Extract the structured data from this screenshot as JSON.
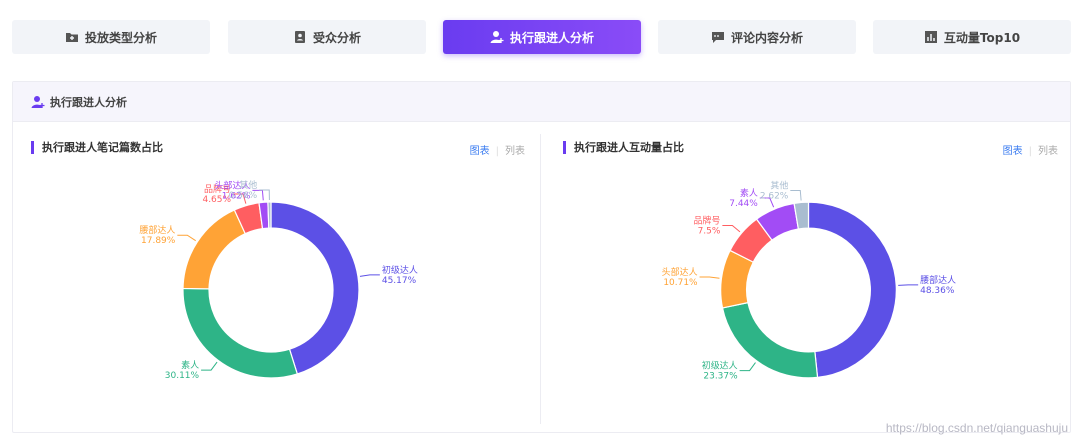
{
  "tabs": [
    {
      "label": "投放类型分析",
      "icon": "folder-icon",
      "active": false
    },
    {
      "label": "受众分析",
      "icon": "contact-card-icon",
      "active": false
    },
    {
      "label": "执行跟进人分析",
      "icon": "user-icon",
      "active": true
    },
    {
      "label": "评论内容分析",
      "icon": "comment-icon",
      "active": false
    },
    {
      "label": "互动量Top10",
      "icon": "bar-chart-icon",
      "active": false
    }
  ],
  "panel": {
    "title": "执行跟进人分析"
  },
  "toggle": {
    "chart": "图表",
    "list": "列表"
  },
  "colors": {
    "accent": "#6a3cf0"
  },
  "chart_data": [
    {
      "type": "pie",
      "title": "执行跟进人笔记篇数占比",
      "donut": true,
      "slices": [
        {
          "name": "初级达人",
          "value": 45.17,
          "label": "45.17%",
          "color": "#5c50e6"
        },
        {
          "name": "素人",
          "value": 30.11,
          "label": "30.11%",
          "color": "#2eb487"
        },
        {
          "name": "腰部达人",
          "value": 17.89,
          "label": "17.89%",
          "color": "#ffa336"
        },
        {
          "name": "品牌号",
          "value": 4.65,
          "label": "4.65%",
          "color": "#ff5e61"
        },
        {
          "name": "头部达人",
          "value": 1.62,
          "label": "1.62%",
          "color": "#a24cf5"
        },
        {
          "name": "其他",
          "value": 0.56,
          "label": "0.56%",
          "color": "#a9bdd0"
        }
      ]
    },
    {
      "type": "pie",
      "title": "执行跟进人互动量占比",
      "donut": true,
      "slices": [
        {
          "name": "腰部达人",
          "value": 48.36,
          "label": "48.36%",
          "color": "#5c50e6"
        },
        {
          "name": "初级达人",
          "value": 23.37,
          "label": "23.37%",
          "color": "#2eb487"
        },
        {
          "name": "头部达人",
          "value": 10.71,
          "label": "10.71%",
          "color": "#ffa336"
        },
        {
          "name": "品牌号",
          "value": 7.5,
          "label": "7.5%",
          "color": "#ff5e61"
        },
        {
          "name": "素人",
          "value": 7.44,
          "label": "7.44%",
          "color": "#a24cf5"
        },
        {
          "name": "其他",
          "value": 2.62,
          "label": "2.62%",
          "color": "#a9bdd0"
        }
      ]
    }
  ],
  "watermark": "https://blog.csdn.net/qianguashuju"
}
